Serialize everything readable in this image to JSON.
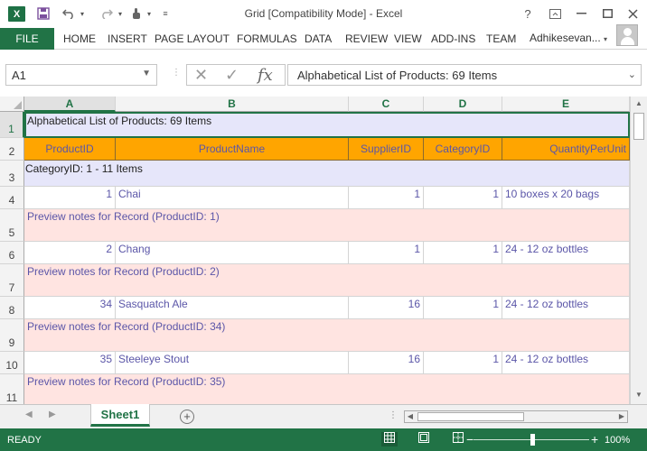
{
  "window": {
    "title": "Grid  [Compatibility Mode] - Excel",
    "help": "?",
    "app_icon": "X"
  },
  "ribbon": {
    "file": "FILE",
    "tabs": [
      "HOME",
      "INSERT",
      "PAGE LAYOUT",
      "FORMULAS",
      "DATA",
      "REVIEW",
      "VIEW",
      "ADD-INS",
      "TEAM"
    ],
    "user": "Adhikesevan..."
  },
  "formula_bar": {
    "name_box": "A1",
    "content": "Alphabetical List of Products: 69 Items"
  },
  "columns": [
    "A",
    "B",
    "C",
    "D",
    "E"
  ],
  "rows": [
    "1",
    "2",
    "3",
    "4",
    "5",
    "6",
    "7",
    "8",
    "9",
    "10",
    "11"
  ],
  "sheet": {
    "title_cell": "Alphabetical List of Products: 69 Items",
    "headers": [
      "ProductID",
      "ProductName",
      "SupplierID",
      "CategoryID",
      "QuantityPerUnit"
    ],
    "group_label": "CategoryID: 1 - 11 Items",
    "records": [
      {
        "product_id": "1",
        "product_name": "Chai",
        "supplier_id": "1",
        "category_id": "1",
        "quantity": "10 boxes x 20 bags",
        "notes": "Preview notes for Record (ProductID: 1)"
      },
      {
        "product_id": "2",
        "product_name": "Chang",
        "supplier_id": "1",
        "category_id": "1",
        "quantity": "24 - 12 oz bottles",
        "notes": "Preview notes for Record (ProductID: 2)"
      },
      {
        "product_id": "34",
        "product_name": "Sasquatch Ale",
        "supplier_id": "16",
        "category_id": "1",
        "quantity": "24 - 12 oz bottles",
        "notes": "Preview notes for Record (ProductID: 34)"
      },
      {
        "product_id": "35",
        "product_name": "Steeleye Stout",
        "supplier_id": "16",
        "category_id": "1",
        "quantity": "24 - 12 oz bottles",
        "notes": "Preview notes for Record (ProductID: 35)"
      }
    ],
    "last_notes": "Preview notes for Record (ProductID: 35)"
  },
  "tabs_bar": {
    "sheet_name": "Sheet1",
    "add": "+"
  },
  "status": {
    "text": "READY",
    "zoom": "100%"
  },
  "icons": {
    "save": "save-icon",
    "undo": "undo-icon",
    "redo": "redo-icon",
    "touch": "touch-mode-icon"
  }
}
